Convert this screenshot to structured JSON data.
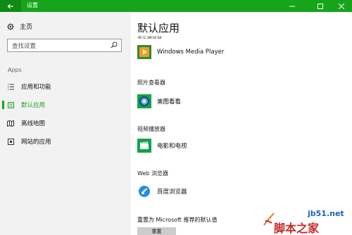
{
  "window": {
    "title": "设置"
  },
  "sidebar": {
    "home_label": "主页",
    "search_placeholder": "查找设置",
    "section_label": "Apps",
    "items": [
      {
        "label": "应用和功能",
        "icon": "list-icon"
      },
      {
        "label": "默认应用",
        "icon": "default-apps-icon",
        "active": true
      },
      {
        "label": "离线地图",
        "icon": "map-icon"
      },
      {
        "label": "网站的应用",
        "icon": "website-icon"
      }
    ]
  },
  "main": {
    "title": "默认应用",
    "clipped_category": "音乐播放器",
    "categories": [
      {
        "label": "",
        "app": "Windows Media Player",
        "icon": "windows-media-player-icon"
      },
      {
        "label": "照片查看器",
        "app": "美图看看",
        "icon": "meitu-icon"
      },
      {
        "label": "视频播放器",
        "app": "电影和电视",
        "icon": "movies-tv-icon"
      },
      {
        "label": "Web 浏览器",
        "app": "百度浏览器",
        "icon": "baidu-browser-icon"
      }
    ],
    "reset_label": "重置为 Microsoft 推荐的默认值",
    "reset_button": "重置"
  },
  "watermark": {
    "url": "jb51.net",
    "brand": "脚本之家"
  },
  "colors": {
    "accent": "#16a51a",
    "active_text": "#18a31e"
  }
}
